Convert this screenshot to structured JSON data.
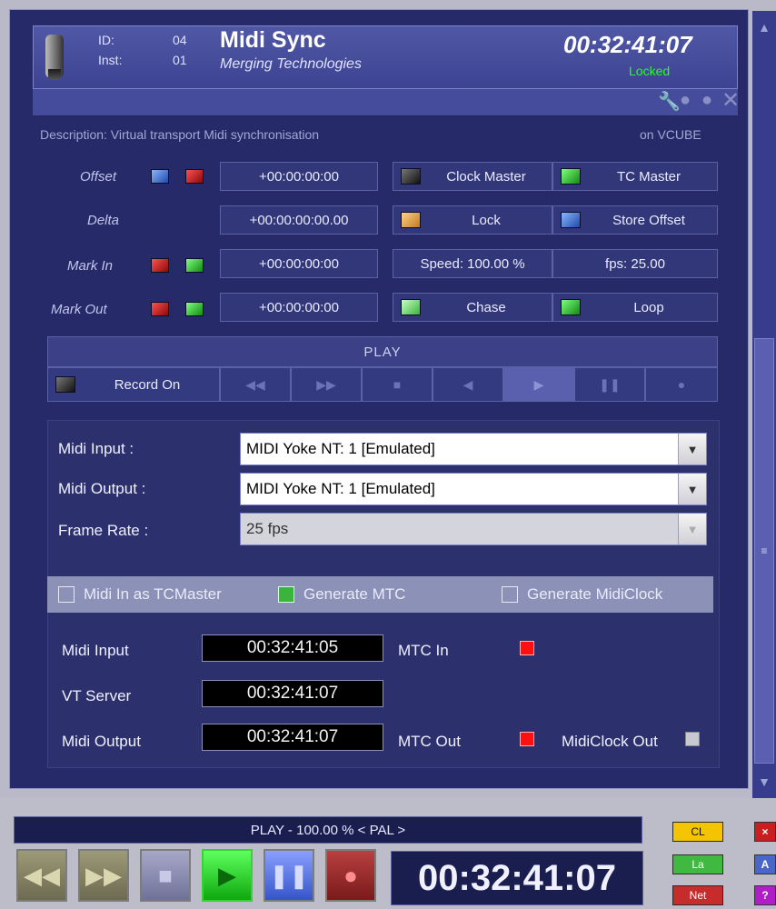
{
  "header": {
    "id_label": "ID:",
    "id_value": "04",
    "inst_label": "Inst:",
    "inst_value": "01",
    "title": "Midi Sync",
    "subtitle": "Merging Technologies",
    "timecode": "00:32:41:07",
    "status": "Locked"
  },
  "description": {
    "text": "Description: Virtual transport Midi synchronisation",
    "location": "on VCUBE"
  },
  "rows": {
    "offset": {
      "label": "Offset",
      "value": "+00:00:00:00"
    },
    "delta": {
      "label": "Delta",
      "value": "+00:00:00:00.00"
    },
    "mark_in": {
      "label": "Mark In",
      "value": "+00:00:00:00"
    },
    "mark_out": {
      "label": "Mark Out",
      "value": "+00:00:00:00"
    }
  },
  "buttons": {
    "clock_master": "Clock Master",
    "tc_master": "TC Master",
    "lock": "Lock",
    "store_offset": "Store Offset",
    "speed": "Speed: 100.00 %",
    "fps": "fps: 25.00",
    "chase": "Chase",
    "loop": "Loop",
    "record_on": "Record On"
  },
  "transport": {
    "state": "PLAY",
    "icons": [
      "◀◀",
      "▶▶",
      "■",
      "◀",
      "▶",
      "❚❚",
      "●"
    ]
  },
  "midi": {
    "input_label": "Midi Input :",
    "input_value": "MIDI Yoke NT:  1 [Emulated]",
    "output_label": "Midi Output :",
    "output_value": "MIDI Yoke NT:  1 [Emulated]",
    "framerate_label": "Frame Rate :",
    "framerate_value": "25 fps"
  },
  "options": {
    "midi_in_tcmaster": "Midi In as TCMaster",
    "generate_mtc": "Generate MTC",
    "generate_midiclock": "Generate MidiClock"
  },
  "monitor": {
    "midi_input_label": "Midi Input",
    "midi_input_tc": "00:32:41:05",
    "mtc_in_label": "MTC In",
    "vt_server_label": "VT Server",
    "vt_server_tc": "00:32:41:07",
    "midi_output_label": "Midi Output",
    "midi_output_tc": "00:32:41:07",
    "mtc_out_label": "MTC Out",
    "midiclock_out_label": "MidiClock Out"
  },
  "bottom": {
    "status": "PLAY - 100.00 % < PAL >",
    "timecode": "00:32:41:07",
    "cl": "CL",
    "la": "La",
    "net": "Net",
    "x": "×",
    "a": "A",
    "q": "?"
  },
  "colors": {
    "panel_bg": "#262a68",
    "accent_green": "#22ff22",
    "led_red": "#ff1010"
  }
}
